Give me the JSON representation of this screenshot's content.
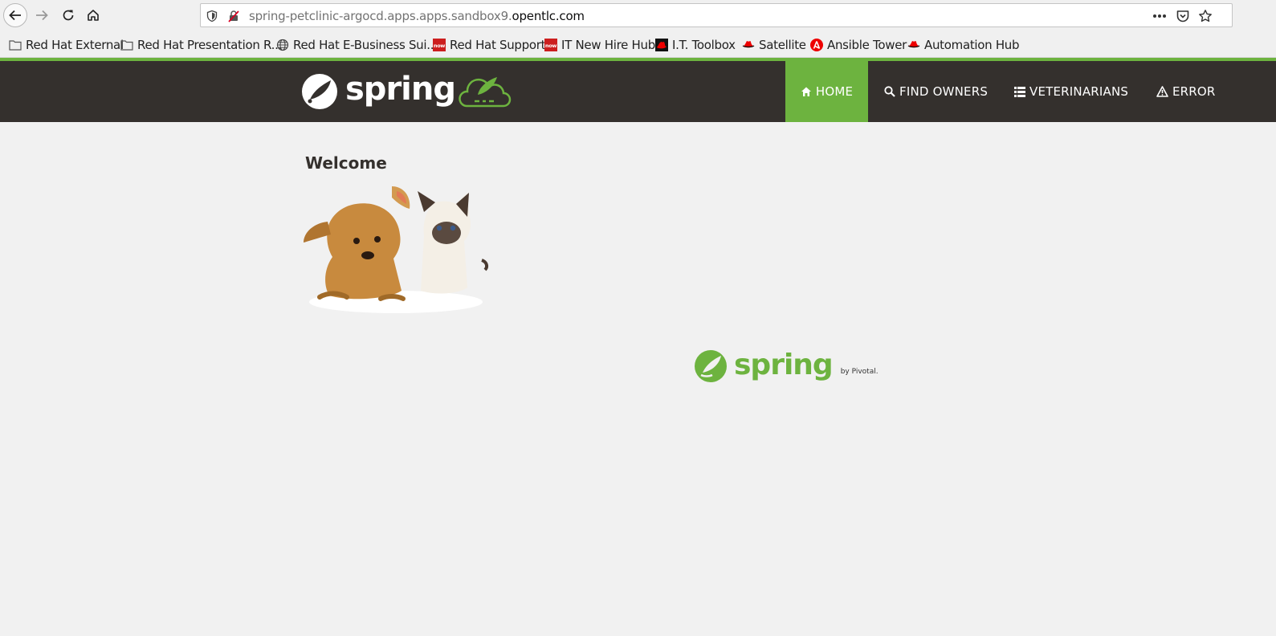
{
  "browser": {
    "url_prefix": "spring-petclinic-argocd.apps.apps.sandbox9.",
    "url_domain": "opentlc.com",
    "bookmarks": [
      {
        "label": "Red Hat External",
        "icon": "folder-icon"
      },
      {
        "label": "Red Hat Presentation R...",
        "icon": "folder-icon"
      },
      {
        "label": "Red Hat E-Business Sui...",
        "icon": "globe-icon"
      },
      {
        "label": "Red Hat Support",
        "icon": "servicenow-icon"
      },
      {
        "label": "IT New Hire Hub",
        "icon": "servicenow-icon"
      },
      {
        "label": "I.T. Toolbox",
        "icon": "redhat-icon"
      },
      {
        "label": "Satellite",
        "icon": "redhat-hat-icon"
      },
      {
        "label": "Ansible Tower",
        "icon": "ansible-icon"
      },
      {
        "label": "Automation Hub",
        "icon": "redhat-hat-icon"
      }
    ]
  },
  "site": {
    "logo_text": "spring",
    "nav": [
      {
        "label": "HOME",
        "icon": "home-icon",
        "active": true
      },
      {
        "label": "FIND OWNERS",
        "icon": "search-icon",
        "active": false
      },
      {
        "label": "VETERINARIANS",
        "icon": "list-icon",
        "active": false
      },
      {
        "label": "ERROR",
        "icon": "warning-icon",
        "active": false
      }
    ],
    "heading": "Welcome",
    "footer_logo_text": "spring",
    "footer_by": "by Pivotal."
  },
  "colors": {
    "brand_green": "#6db33f",
    "navbar_dark": "#34302d",
    "page_bg": "#f1f1f1"
  }
}
